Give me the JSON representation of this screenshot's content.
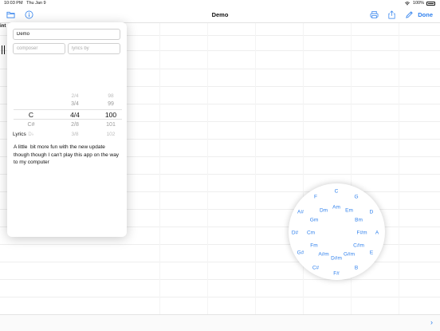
{
  "status": {
    "time": "10:03 PM",
    "date": "Thu Jan 9",
    "battery": "100%"
  },
  "navbar": {
    "title": "Demo",
    "done_label": "Done"
  },
  "peek": {
    "text": "int"
  },
  "info": {
    "title_value": "Demo",
    "composer_placeholder": "composer",
    "lyricsby_placeholder": "lyrics by",
    "lyrics_label": "Lyrics",
    "lyrics_text": "A little  bit more fun with the new update though though I can't play this app on the way to my computer"
  },
  "picker": {
    "keys": [
      "",
      "",
      "C",
      "C#",
      "D♭"
    ],
    "times": [
      "2/4",
      "3/4",
      "4/4",
      "2/8",
      "3/8"
    ],
    "tempos": [
      "98",
      "99",
      "100",
      "101",
      "102"
    ]
  },
  "wheel": {
    "outer": [
      "C",
      "G",
      "D",
      "A",
      "E",
      "B",
      "F#",
      "C#",
      "G#",
      "D#",
      "A#",
      "F"
    ],
    "middle": [
      "Am",
      "Em",
      "Bm",
      "F#m",
      "C#m",
      "G#m",
      "D#m",
      "A#m",
      "Fm",
      "Cm",
      "Gm",
      "Dm"
    ]
  },
  "bottom": {
    "chevron": "›"
  }
}
